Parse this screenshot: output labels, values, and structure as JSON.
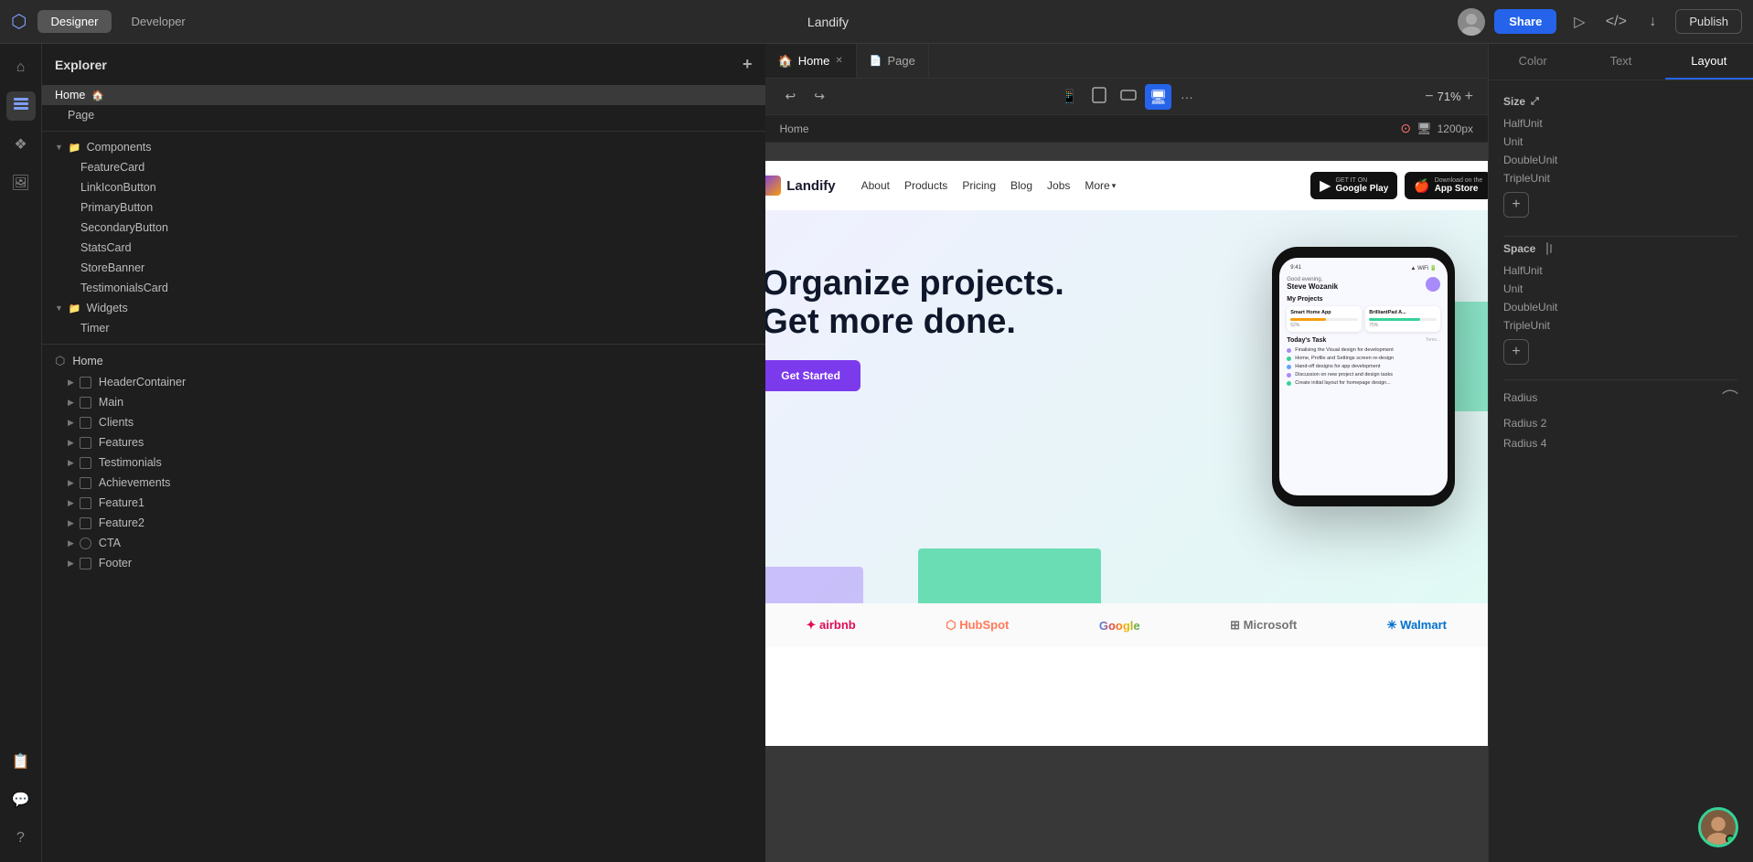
{
  "app": {
    "title": "Landify",
    "mode_designer": "Designer",
    "mode_developer": "Developer",
    "share_label": "Share",
    "publish_label": "Publish"
  },
  "tabs": [
    {
      "label": "Home",
      "active": true,
      "type": "home"
    },
    {
      "label": "Page",
      "active": false,
      "type": "page"
    }
  ],
  "toolbar": {
    "zoom": "71%"
  },
  "breadcrumb": {
    "label": "Home",
    "size": "1200px"
  },
  "sidebar": {
    "title": "Explorer",
    "tree": [
      {
        "label": "Home",
        "level": 0,
        "active": true,
        "icon": "home"
      },
      {
        "label": "Page",
        "level": 0,
        "active": false
      },
      {
        "label": "Components",
        "level": 1,
        "type": "folder"
      },
      {
        "label": "FeatureCard",
        "level": 2
      },
      {
        "label": "LinkIconButton",
        "level": 2
      },
      {
        "label": "PrimaryButton",
        "level": 2
      },
      {
        "label": "SecondaryButton",
        "level": 2
      },
      {
        "label": "StatsCard",
        "level": 2
      },
      {
        "label": "StoreBanner",
        "level": 2
      },
      {
        "label": "TestimonialsCard",
        "level": 2
      },
      {
        "label": "Widgets",
        "level": 1,
        "type": "folder"
      },
      {
        "label": "Timer",
        "level": 2
      },
      {
        "label": "Home",
        "level": 0,
        "section": true
      },
      {
        "label": "HeaderContainer",
        "level": 1,
        "hasBox": true
      },
      {
        "label": "Main",
        "level": 1,
        "hasBox": true
      },
      {
        "label": "Clients",
        "level": 1,
        "hasBox": true
      },
      {
        "label": "Features",
        "level": 1,
        "hasBox": true
      },
      {
        "label": "Testimonials",
        "level": 1,
        "hasBox": true
      },
      {
        "label": "Achievements",
        "level": 1,
        "hasBox": true
      },
      {
        "label": "Feature1",
        "level": 1,
        "hasBox": true
      },
      {
        "label": "Feature2",
        "level": 1,
        "hasBox": true
      },
      {
        "label": "CTA",
        "level": 1,
        "hasCTA": true
      },
      {
        "label": "Footer",
        "level": 1,
        "hasBox": true
      }
    ]
  },
  "site": {
    "logo_text": "Landify",
    "nav_links": [
      "About",
      "Products",
      "Pricing",
      "Blog",
      "Jobs"
    ],
    "nav_more": "More",
    "google_play_sub": "GET IT ON",
    "google_play_name": "Google Play",
    "app_store_sub": "Download on the",
    "app_store_name": "App Store",
    "hero_title_line1": "Organize projects.",
    "hero_title_line2": "Get more done.",
    "cta_label": "Get Started",
    "phone_time": "9:41",
    "phone_greeting": "Good evening,",
    "phone_name": "Steve Wozanik",
    "phone_projects_title": "My Projects",
    "phone_project1": "Smart Home App",
    "phone_project2": "BrilliantPad A...",
    "phone_tasks_title": "Today's Task",
    "phone_tasks": [
      "Finalising the Visual design for development",
      "Home, Profile and Settings screen re-design",
      "Hand-off designs for app development",
      "Discussion on new project and design tasks",
      "Create initial layout for homepage design..."
    ],
    "clients": [
      "airbnb",
      "HubSpot",
      "Google",
      "Microsoft",
      "Walmart"
    ]
  },
  "right_panel": {
    "tabs": [
      "Color",
      "Text",
      "Layout"
    ],
    "active_tab": "Layout",
    "size_label": "Size",
    "size_props": [
      {
        "label": "HalfUnit",
        "value": ""
      },
      {
        "label": "Unit",
        "value": ""
      },
      {
        "label": "DoubleUnit",
        "value": ""
      },
      {
        "label": "TripleUnit",
        "value": ""
      }
    ],
    "space_label": "Space",
    "space_props": [
      {
        "label": "HalfUnit",
        "value": ""
      },
      {
        "label": "Unit",
        "value": ""
      },
      {
        "label": "DoubleUnit",
        "value": ""
      },
      {
        "label": "TripleUnit",
        "value": ""
      }
    ],
    "radius_label": "Radius",
    "radius2_label": "Radius 2",
    "radius4_label": "Radius 4"
  },
  "footer_label": "Footer"
}
